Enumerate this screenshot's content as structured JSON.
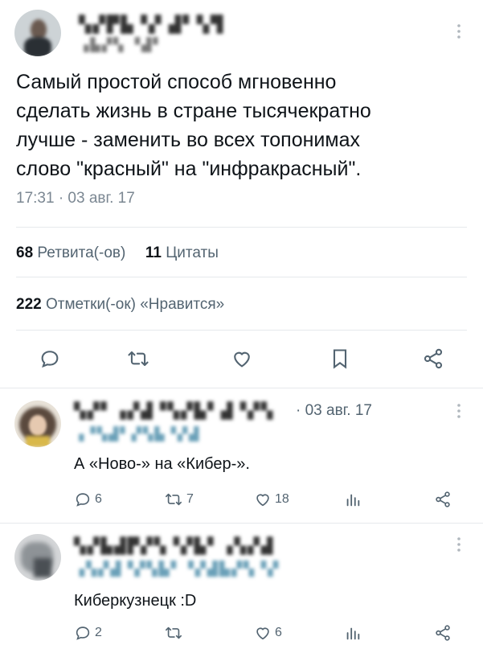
{
  "tweet": {
    "author_name": "▚▞▛▙▝▞ ▟▘▚▜",
    "author_handle": "▗▙▞▚ ▝▟▘",
    "text_lines": [
      "Самый простой способ мгновенно",
      "сделать жизнь в стране тысячекратно",
      "лучше - заменить во всех топонимах",
      "слово \"красный\" на \"инфракрасный\"."
    ],
    "timestamp": "17:31 · 03 авг. 17",
    "retweets_count": "68",
    "retweets_label": "Ретвита(-ов)",
    "quotes_count": "11",
    "quotes_label": "Цитаты",
    "likes_count": "222",
    "likes_label": "Отметки(-ок) «Нравится»"
  },
  "replies": [
    {
      "author_name": "▚▞▘▗▞▟▝▚▞▙▘▟▝▞▚",
      "author_handle": "▗▝▚▟▘▞▚▙▝▞▟",
      "date": "· 03 авг. 17",
      "text": "А «Ново-» на «Кибер-».",
      "reply_count": "6",
      "retweet_count": "7",
      "like_count": "18"
    },
    {
      "author_name": "▚▞▙▟▛▞▚▝▞▙▘▗▚▞▟",
      "author_handle": "▗▚▞▟▝▞▚▙▘▝▞▟▙▞▚▝▞",
      "date": "",
      "text": "Киберкузнецк :D",
      "reply_count": "2",
      "retweet_count": "",
      "like_count": "6"
    }
  ],
  "colors": {
    "text": "#0f1419",
    "secondary": "#536471",
    "divider": "#e6e9ec"
  },
  "icons": [
    "reply-icon",
    "retweet-icon",
    "like-icon",
    "bookmark-icon",
    "share-icon",
    "views-icon",
    "more-icon"
  ]
}
